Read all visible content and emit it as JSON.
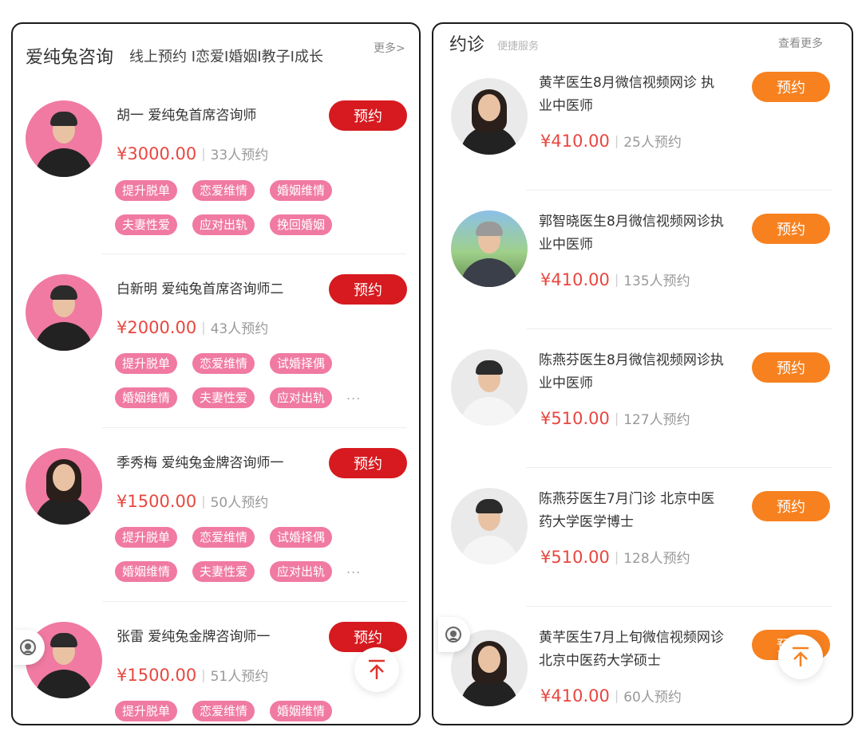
{
  "left": {
    "header": {
      "title": "爱纯兔咨询",
      "subtitle": "线上预约 I恋爱I婚姻I教子I成长",
      "more": "更多>"
    },
    "items": [
      {
        "name": "胡一  爱纯兔首席咨询师",
        "price": "¥3000.00",
        "count": "33人预约",
        "button": "预约",
        "tags": [
          "提升脱单",
          "恋爱维情",
          "婚姻维情",
          "夫妻性爱",
          "应对出轨",
          "挽回婚姻"
        ],
        "more": ""
      },
      {
        "name": "白新明  爱纯兔首席咨询师二",
        "price": "¥2000.00",
        "count": "43人预约",
        "button": "预约",
        "tags": [
          "提升脱单",
          "恋爱维情",
          "试婚择偶",
          "婚姻维情",
          "夫妻性爱",
          "应对出轨"
        ],
        "more": "..."
      },
      {
        "name": "季秀梅  爱纯兔金牌咨询师一",
        "price": "¥1500.00",
        "count": "50人预约",
        "button": "预约",
        "tags": [
          "提升脱单",
          "恋爱维情",
          "试婚择偶",
          "婚姻维情",
          "夫妻性爱",
          "应对出轨"
        ],
        "more": "..."
      },
      {
        "name": "张雷  爱纯兔金牌咨询师一",
        "price": "¥1500.00",
        "count": "51人预约",
        "button": "预约",
        "tags": [
          "提升脱单",
          "恋爱维情",
          "婚姻维情"
        ],
        "more": ""
      }
    ]
  },
  "right": {
    "header": {
      "title": "约诊",
      "subtitle": "便捷服务",
      "more": "查看更多"
    },
    "items": [
      {
        "title": "黄芊医生8月微信视频网诊  执业中医师",
        "price": "¥410.00",
        "count": "25人预约",
        "button": "预约"
      },
      {
        "title": "郭智晓医生8月微信视频网诊执业中医师",
        "price": "¥410.00",
        "count": "135人预约",
        "button": "预约"
      },
      {
        "title": "陈燕芬医生8月微信视频网诊执业中医师",
        "price": "¥510.00",
        "count": "127人预约",
        "button": "预约"
      },
      {
        "title": "陈燕芬医生7月门诊  北京中医药大学医学博士",
        "price": "¥510.00",
        "count": "128人预约",
        "button": "预约"
      },
      {
        "title": "黄芊医生7月上旬微信视频网诊  北京中医药大学硕士",
        "price": "¥410.00",
        "count": "60人预约",
        "button": "预约"
      }
    ]
  },
  "colors": {
    "price": "#e8473f",
    "button_red": "#d61a1f",
    "button_orange": "#f7811f",
    "tag_pink": "#f07aa1"
  },
  "icons": {
    "back_to_top": "arrow-up-icon",
    "customer_service": "headset-icon"
  }
}
